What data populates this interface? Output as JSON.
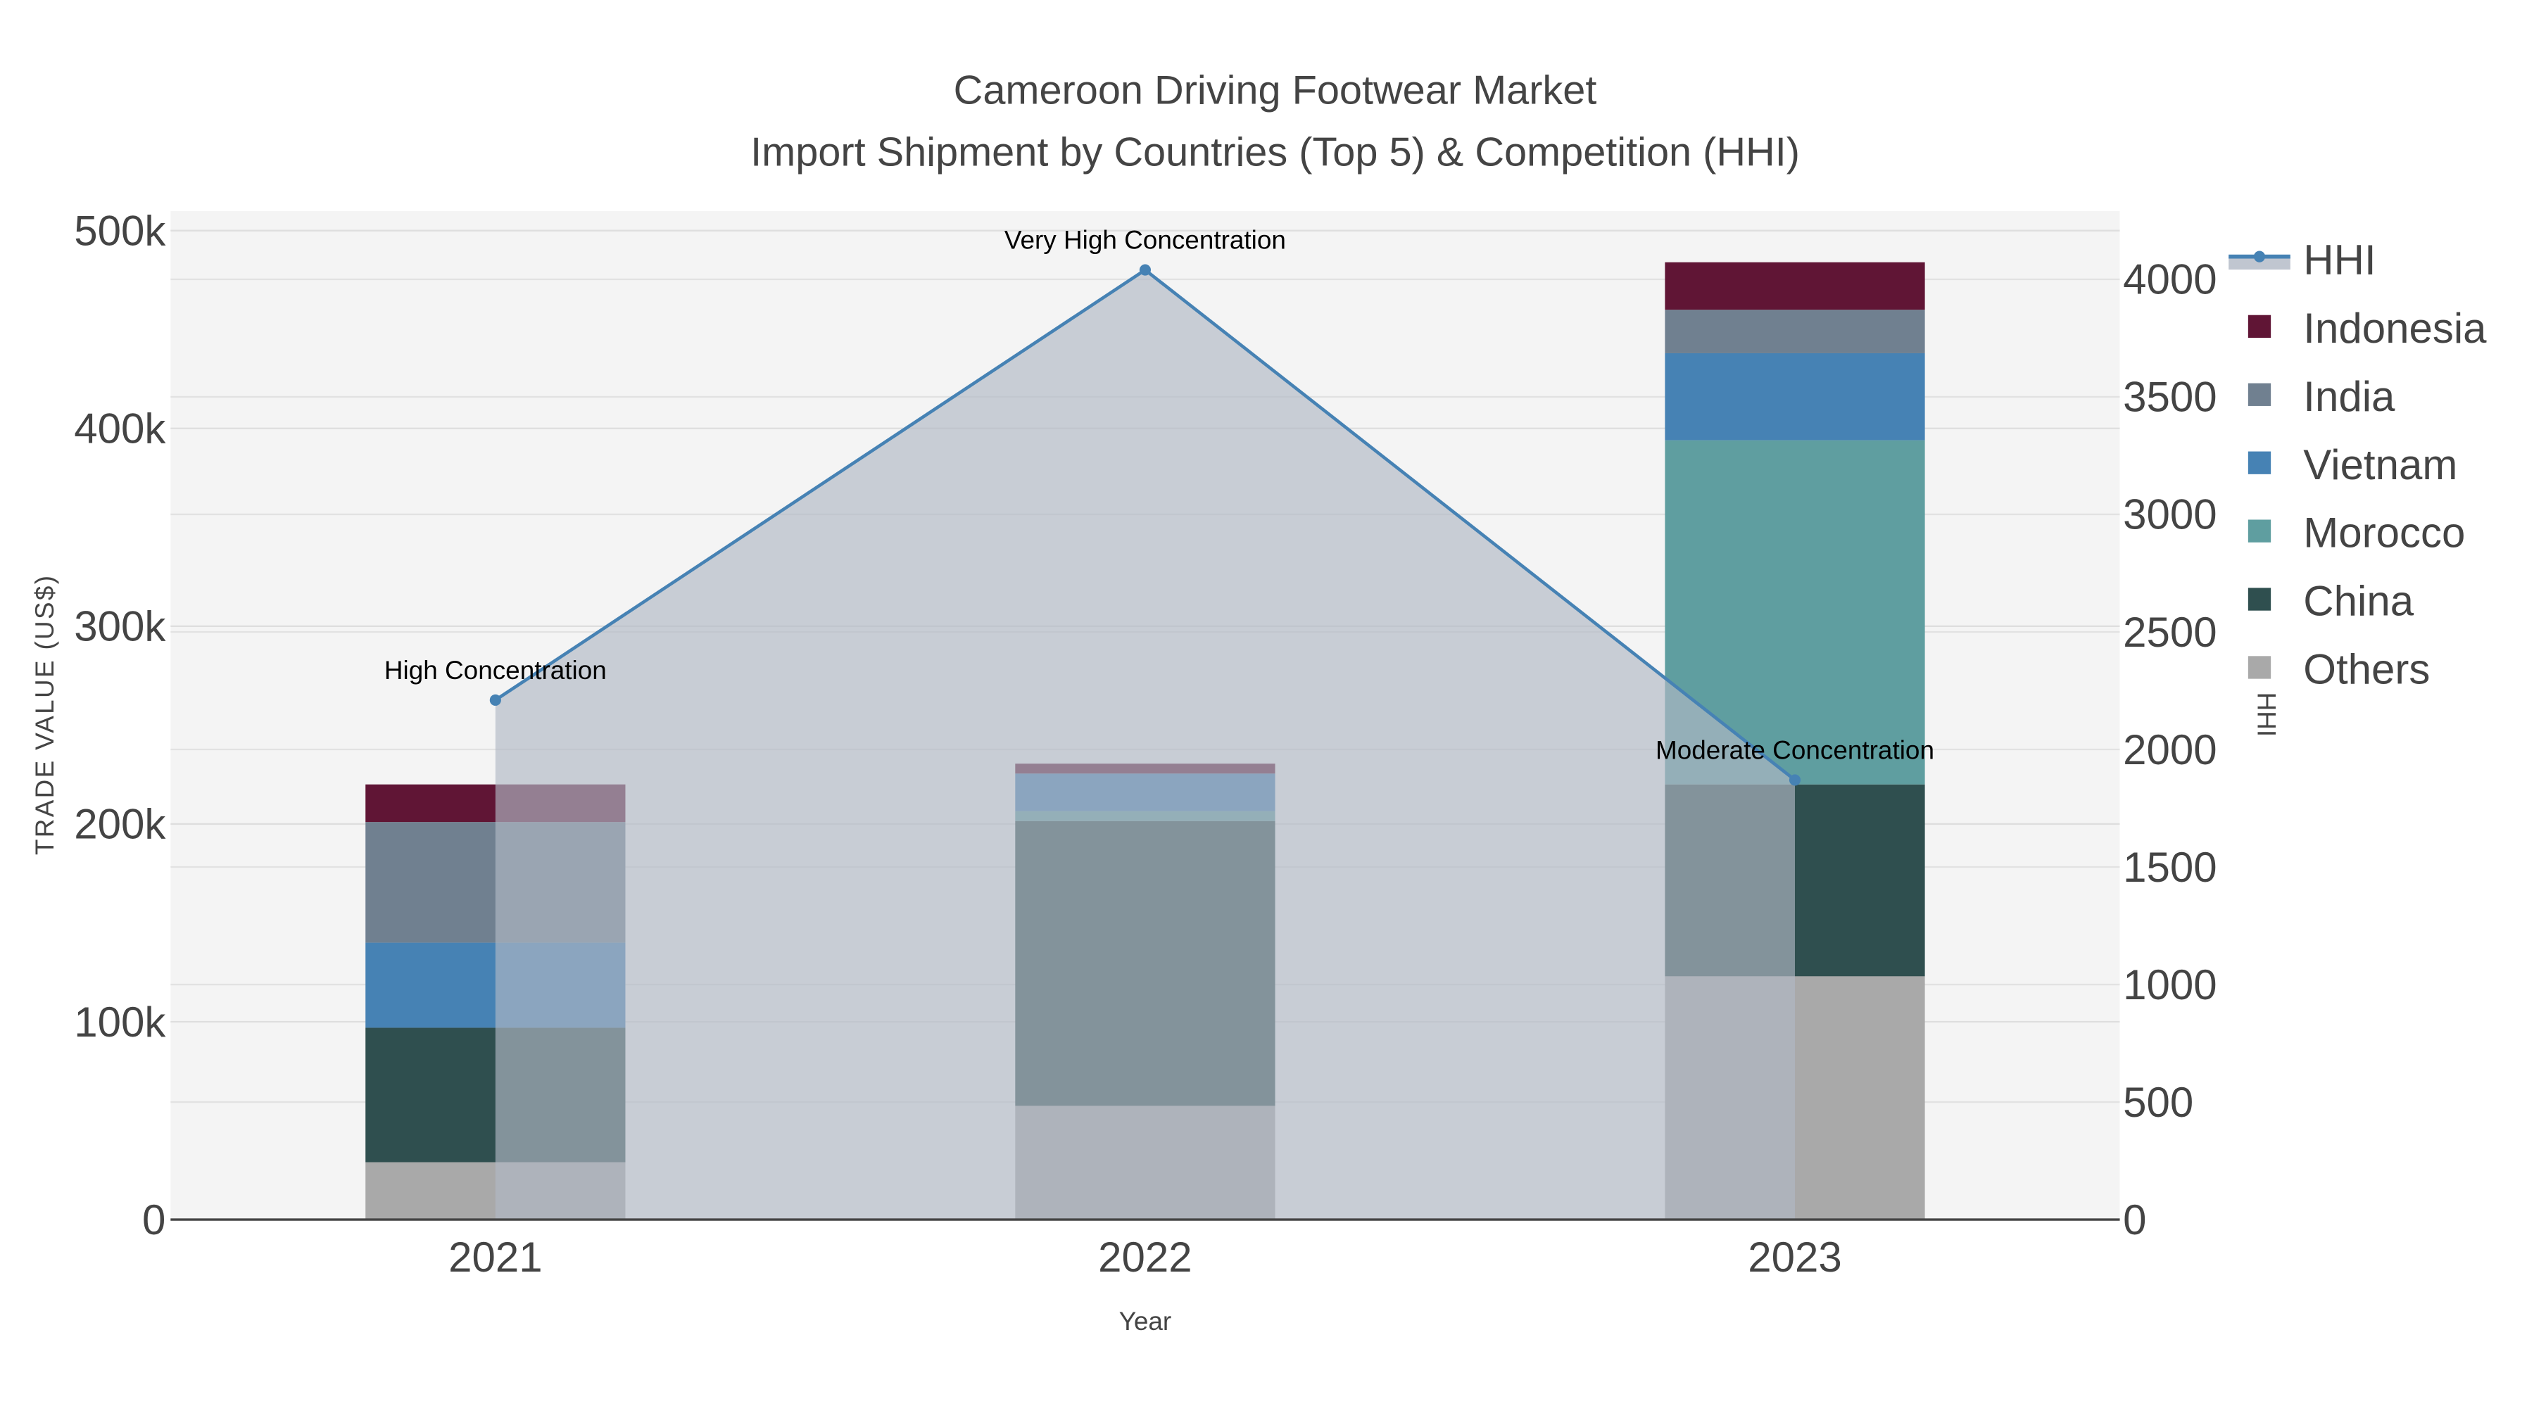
{
  "chart_data": {
    "type": "bar",
    "title": "Cameroon Driving Footwear Market",
    "subtitle": "Import Shipment by Countries (Top 5) & Competition (HHI)",
    "xlabel": "Year",
    "ylabel": "TRADE VALUE (US$)",
    "y2label": "HHI",
    "categories": [
      "2021",
      "2022",
      "2023"
    ],
    "ylim": [
      0,
      510000
    ],
    "y2lim": [
      0,
      4300
    ],
    "yticks": [
      {
        "v": 0,
        "label": "0"
      },
      {
        "v": 100000,
        "label": "100k"
      },
      {
        "v": 200000,
        "label": "200k"
      },
      {
        "v": 300000,
        "label": "300k"
      },
      {
        "v": 400000,
        "label": "400k"
      },
      {
        "v": 500000,
        "label": "500k"
      }
    ],
    "y2ticks": [
      {
        "v": 0,
        "label": "0"
      },
      {
        "v": 500,
        "label": "500"
      },
      {
        "v": 1000,
        "label": "1000"
      },
      {
        "v": 1500,
        "label": "1500"
      },
      {
        "v": 2000,
        "label": "2000"
      },
      {
        "v": 2500,
        "label": "2500"
      },
      {
        "v": 3000,
        "label": "3000"
      },
      {
        "v": 3500,
        "label": "3500"
      },
      {
        "v": 4000,
        "label": "4000"
      }
    ],
    "series": [
      {
        "name": "Others",
        "color": "#a9a9a9",
        "values": [
          29000,
          57500,
          123000
        ]
      },
      {
        "name": "China",
        "color": "#2f4f4f",
        "values": [
          68000,
          144000,
          97000
        ]
      },
      {
        "name": "Morocco",
        "color": "#5f9ea0",
        "values": [
          0,
          5000,
          174000
        ]
      },
      {
        "name": "Vietnam",
        "color": "#4682b4",
        "values": [
          43000,
          19000,
          44000
        ]
      },
      {
        "name": "India",
        "color": "#708090",
        "values": [
          61000,
          0,
          22000
        ]
      },
      {
        "name": "Indonesia",
        "color": "#601535",
        "values": [
          19000,
          5000,
          24000
        ]
      }
    ],
    "hhi": {
      "name": "HHI",
      "color": "#4682b4",
      "values": [
        2210,
        4040,
        1870
      ],
      "annotations": [
        "High Concentration",
        "Very High Concentration",
        "Moderate Concentration"
      ]
    },
    "legend_order": [
      "HHI",
      "Indonesia",
      "India",
      "Vietnam",
      "Morocco",
      "China",
      "Others"
    ],
    "legend_position": "right",
    "grid": true
  }
}
